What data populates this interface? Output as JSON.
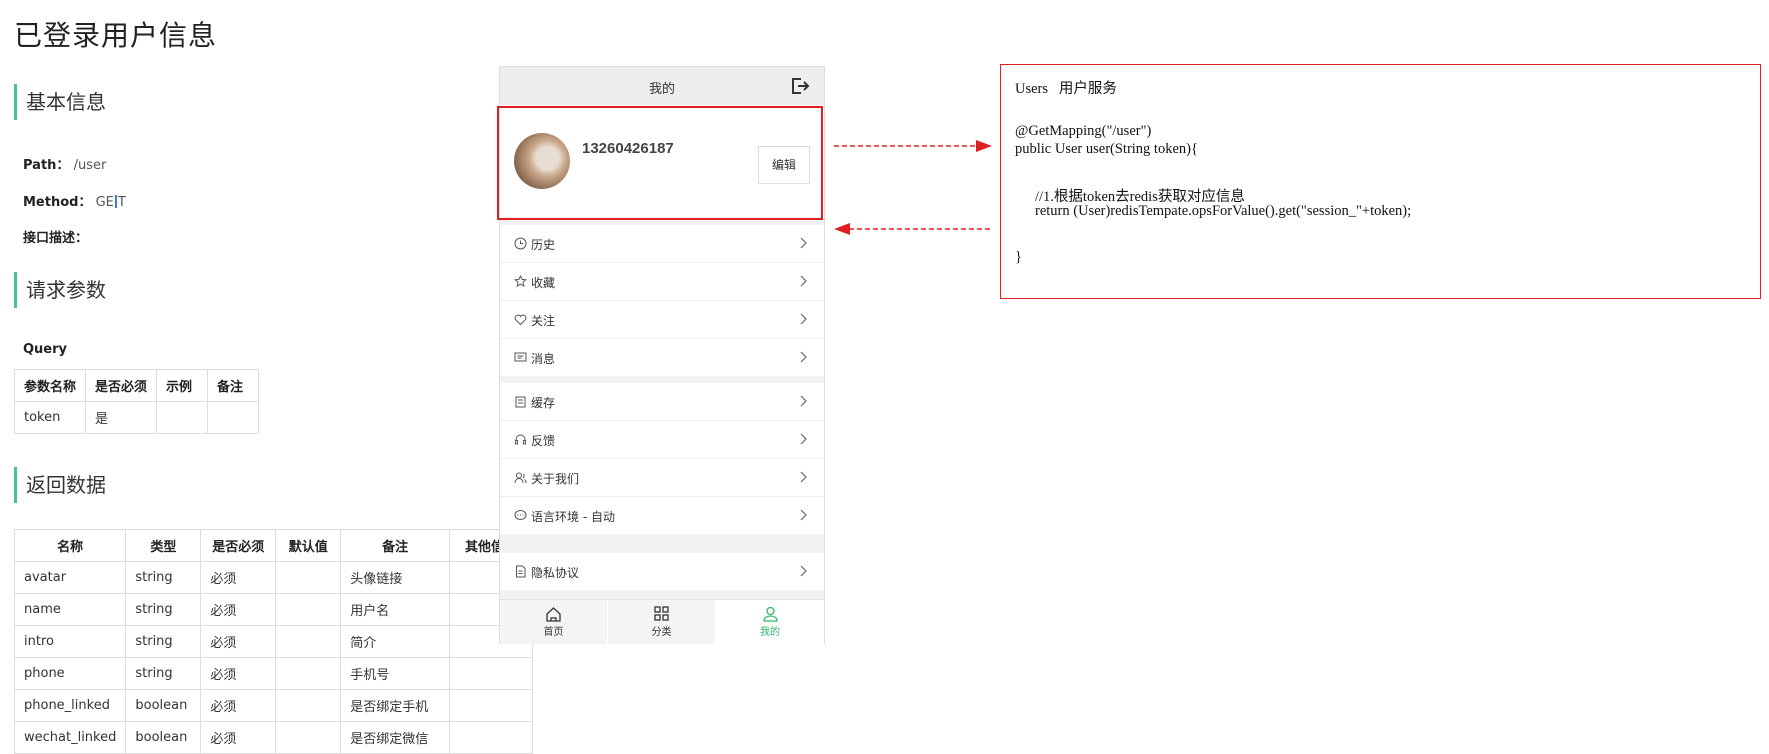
{
  "page": {
    "title": "已登录用户信息"
  },
  "basic_info": {
    "heading": "基本信息",
    "path_label": "Path：",
    "path_value": "/user",
    "method_label": "Method：",
    "method_value_selected": "GE",
    "method_value_rest": "T",
    "desc_label": "接口描述："
  },
  "request": {
    "heading": "请求参数",
    "query_label": "Query",
    "headers": [
      "参数名称",
      "是否必须",
      "示例",
      "备注"
    ],
    "rows": [
      [
        "token",
        "是",
        "",
        ""
      ]
    ]
  },
  "response": {
    "heading": "返回数据",
    "headers": [
      "名称",
      "类型",
      "是否必须",
      "默认值",
      "备注",
      "其他信息"
    ],
    "rows": [
      [
        "avatar",
        "string",
        "必须",
        "",
        "头像链接",
        ""
      ],
      [
        "name",
        "string",
        "必须",
        "",
        "用户名",
        ""
      ],
      [
        "intro",
        "string",
        "必须",
        "",
        "简介",
        ""
      ],
      [
        "phone",
        "string",
        "必须",
        "",
        "手机号",
        ""
      ],
      [
        "phone_linked",
        "boolean",
        "必须",
        "",
        "是否绑定手机",
        ""
      ],
      [
        "wechat_linked",
        "boolean",
        "必须",
        "",
        "是否绑定微信",
        ""
      ]
    ]
  },
  "phone": {
    "title": "我的",
    "phone_number": "13260426187",
    "edit_label": "编辑",
    "menu_group_1": [
      {
        "label": "历史",
        "icon": "clock-icon"
      },
      {
        "label": "收藏",
        "icon": "star-icon"
      },
      {
        "label": "关注",
        "icon": "heart-icon"
      },
      {
        "label": "消息",
        "icon": "message-icon"
      }
    ],
    "menu_group_2": [
      {
        "label": "缓存",
        "icon": "cache-icon"
      },
      {
        "label": "反馈",
        "icon": "headset-icon"
      },
      {
        "label": "关于我们",
        "icon": "people-icon"
      },
      {
        "label": "语言环境 - 自动",
        "icon": "chat-icon"
      }
    ],
    "menu_group_3": [
      {
        "label": "隐私协议",
        "icon": "document-icon"
      }
    ],
    "tabs": [
      {
        "label": "首页",
        "icon": "home-icon"
      },
      {
        "label": "分类",
        "icon": "grid-icon"
      },
      {
        "label": "我的",
        "icon": "user-icon"
      }
    ],
    "active_color": "#2db56b"
  },
  "code": {
    "title": "Users   用户服务",
    "line1": "@GetMapping(\"/user\")",
    "line2": "public User user(String token){",
    "comment": "//1.根据token去redis获取对应信息",
    "line3": "return (User)redisTempate.opsForValue().get(\"session_\"+token);",
    "close": "}"
  },
  "colors": {
    "accent_green": "#4ec08f",
    "annotation_red": "#e02020"
  }
}
